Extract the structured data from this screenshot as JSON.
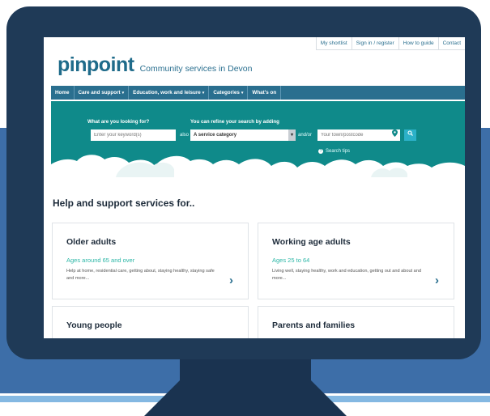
{
  "utility_links": [
    "My shortlist",
    "Sign in / register",
    "How to guide",
    "Contact"
  ],
  "logo": {
    "word": "pinpoint",
    "tagline": "Community services in Devon"
  },
  "nav": [
    {
      "label": "Home",
      "caret": ""
    },
    {
      "label": "Care and support",
      "caret": "▾"
    },
    {
      "label": "Education, work and leisure",
      "caret": "▾"
    },
    {
      "label": "Categories",
      "caret": "▾"
    },
    {
      "label": "What's on",
      "caret": ""
    }
  ],
  "search": {
    "question": "What are you looking for?",
    "refine": "You can refine your search by adding",
    "keyword_placeholder": "Enter your keyword(s)",
    "also": "also",
    "category_value": "A service category",
    "andor": "and/or",
    "town_placeholder": "Your town/postcode",
    "tips": "Search tips"
  },
  "section_heading": "Help and support services for..",
  "cards": [
    {
      "title": "Older adults",
      "sub": "Ages around 65 and over",
      "desc": "Help at home, residential care, getting about, staying healthy, staying safe and more..."
    },
    {
      "title": "Working age adults",
      "sub": "Ages 25 to 64",
      "desc": "Living well, staying healthy, work and education, getting out and about and more..."
    },
    {
      "title": "Young people",
      "sub": "",
      "desc": ""
    },
    {
      "title": "Parents and families",
      "sub": "",
      "desc": ""
    }
  ],
  "colors": {
    "brand": "#2a6f8f",
    "hero": "#0f8a8a",
    "accent": "#2bb6a6",
    "frame": "#1f3a57"
  }
}
